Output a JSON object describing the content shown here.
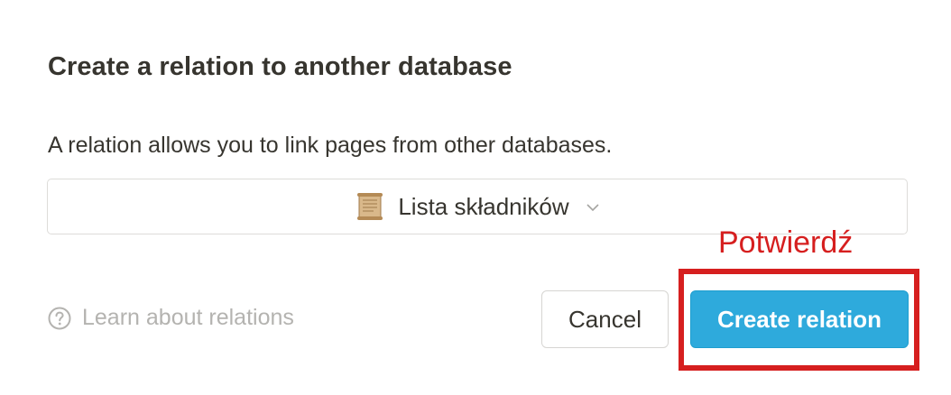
{
  "dialog": {
    "title": "Create a relation to another database",
    "description": "A relation allows you to link pages from other databases.",
    "database_select": {
      "icon": "scroll-icon",
      "selected_value": "Lista składników",
      "chevron": "chevron-down-icon"
    },
    "learn_link": {
      "icon": "help-circle-icon",
      "label": "Learn about relations"
    },
    "buttons": {
      "cancel_label": "Cancel",
      "create_label": "Create relation"
    }
  },
  "annotation": {
    "label": "Potwierdź",
    "color": "#d61f1f"
  },
  "colors": {
    "primary_button": "#2eaadc",
    "text": "#37352f",
    "muted_text": "#b4b3b0",
    "border": "#dddcd9"
  }
}
